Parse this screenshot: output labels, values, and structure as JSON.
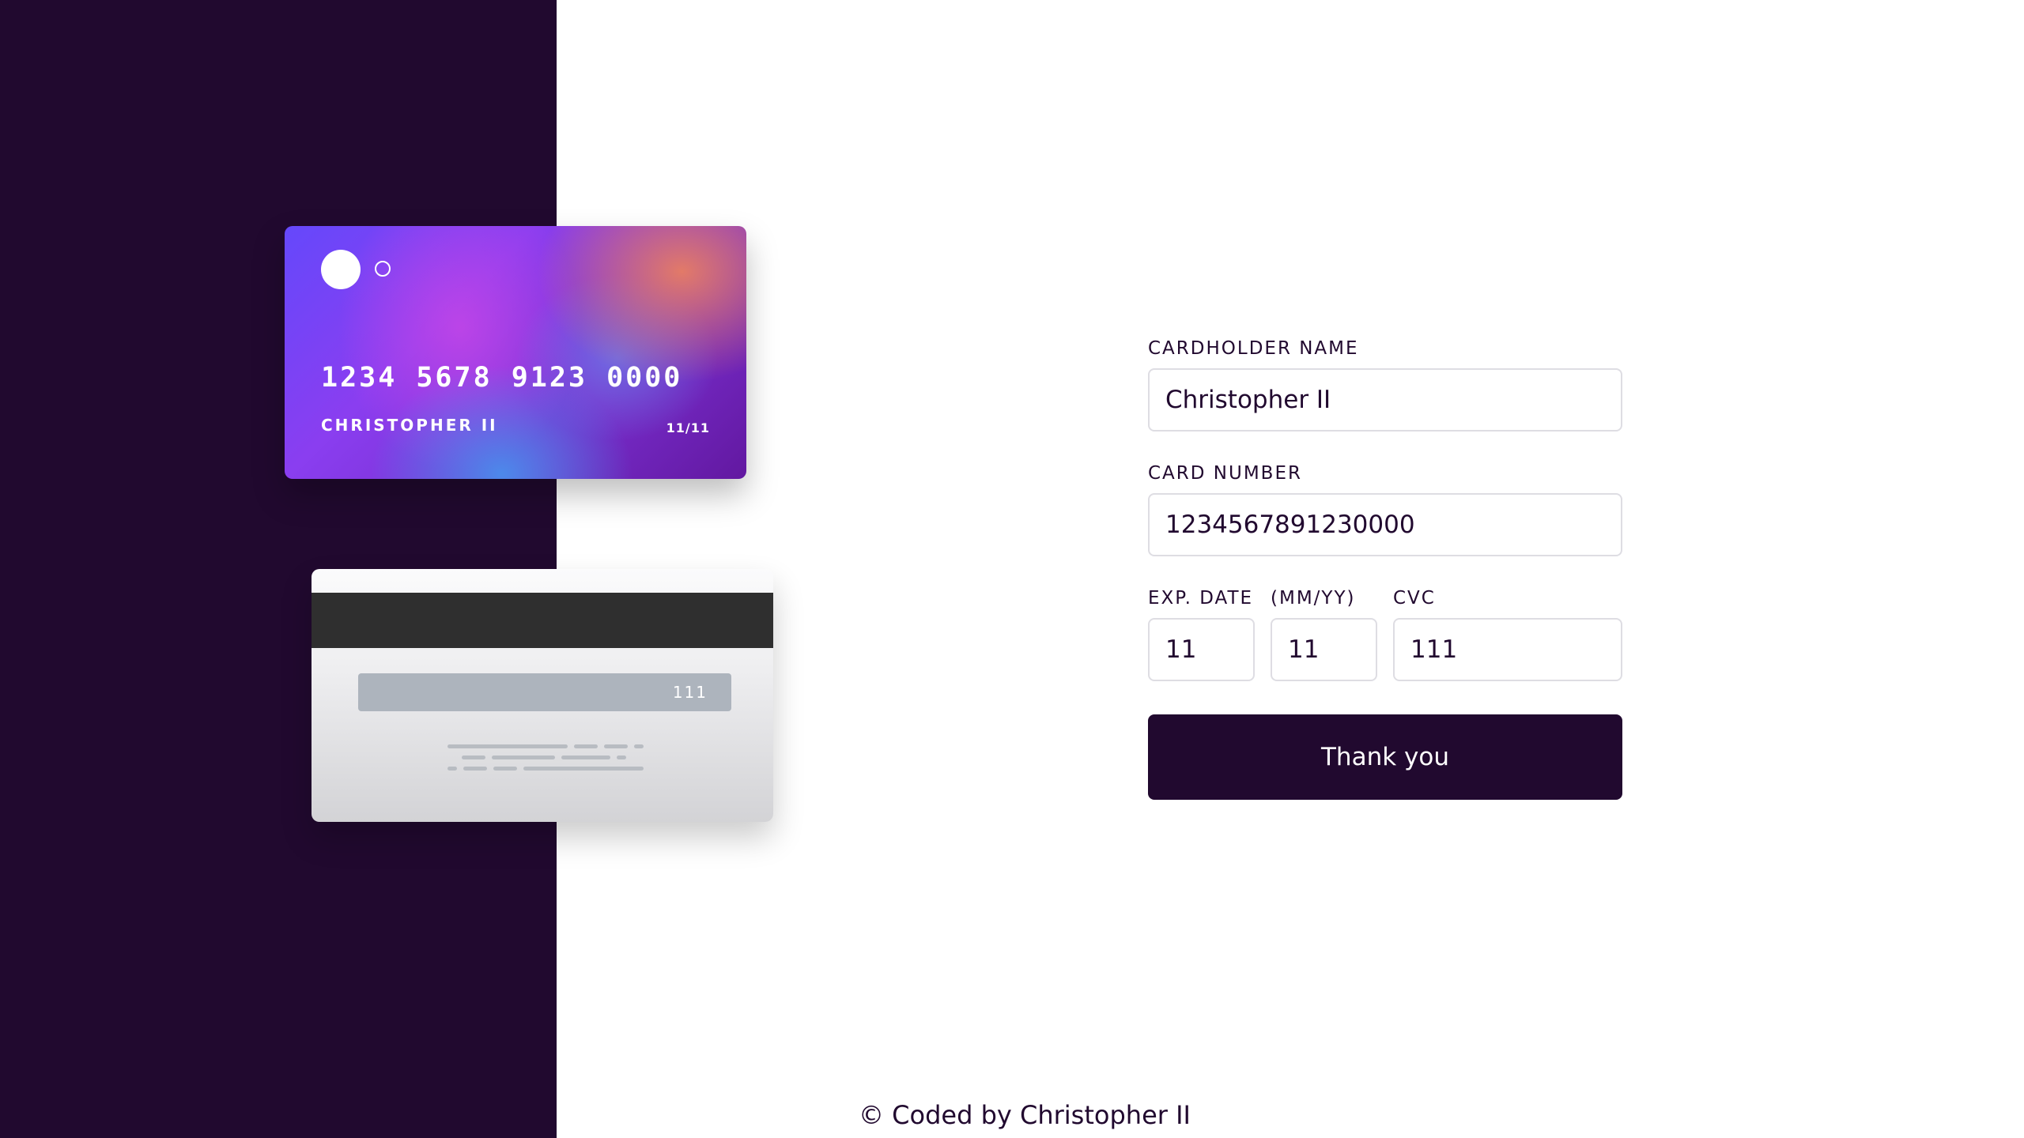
{
  "card_front": {
    "number": "1234 5678 9123 0000",
    "name": "CHRISTOPHER II",
    "exp_month": "11",
    "exp_separator": "/",
    "exp_year": "11"
  },
  "card_back": {
    "cvc": "111"
  },
  "form": {
    "cardholder_label": "CARDHOLDER NAME",
    "cardholder_value": "Christopher II",
    "number_label": "CARD NUMBER",
    "number_value": "1234567891230000",
    "exp_label": "EXP. DATE",
    "mmyy_label": "(MM/YY)",
    "cvc_label": "CVC",
    "exp_month_value": "11",
    "exp_year_value": "11",
    "cvc_value": "111",
    "submit_label": "Thank you"
  },
  "footer": {
    "text": "© Coded by Christopher II"
  },
  "colors": {
    "dark": "#21092f",
    "input_border": "#dedde3",
    "background": "#ffffff"
  }
}
